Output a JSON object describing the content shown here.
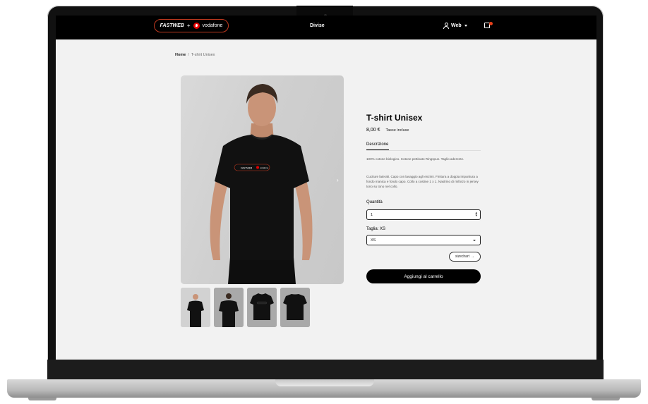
{
  "header": {
    "logo_brand": "FASTWEB",
    "logo_plus": "+",
    "logo_partner": "vodafone",
    "nav_divise": "Divise",
    "user_menu": "Web",
    "cart_count": ""
  },
  "breadcrumb": {
    "home": "Home",
    "separator": "/",
    "current": "T-shirt Unisex"
  },
  "product": {
    "title": "T-shirt Unisex",
    "price": "8,00 €",
    "taxes_note": "Tasse incluse",
    "tab_description": "Descrizione",
    "description_1": "100% cotone biologico. Cotone pettinato Ringspun. Taglio aderente.",
    "description_2": "Cuciture laterali. Capo con lavaggio agli enzimi. Finitura a doppia impuntura a fondo manica e fondo capo. Collo a costine 1 x 1. Nastrino di rinforzo in jersey tono su tono nel collo.",
    "quantity_label": "Quantità",
    "quantity_value": "1",
    "size_label": "Taglia: XS",
    "size_selected": "XS",
    "sizechart_label": "sizechart",
    "sizechart_arrow": "→",
    "add_to_cart": "Aggiungi al carrello",
    "shirt_print_brand": "FASTWEB",
    "shirt_print_partner": "vodafone"
  },
  "colors": {
    "header_bg": "#000000",
    "accent_red": "#e60000",
    "page_bg": "#f2f2f2"
  },
  "icons": {
    "user": "user-icon",
    "cart": "shopping-bag-icon",
    "caret": "chevron-down-icon",
    "next": "chevron-right-icon"
  }
}
